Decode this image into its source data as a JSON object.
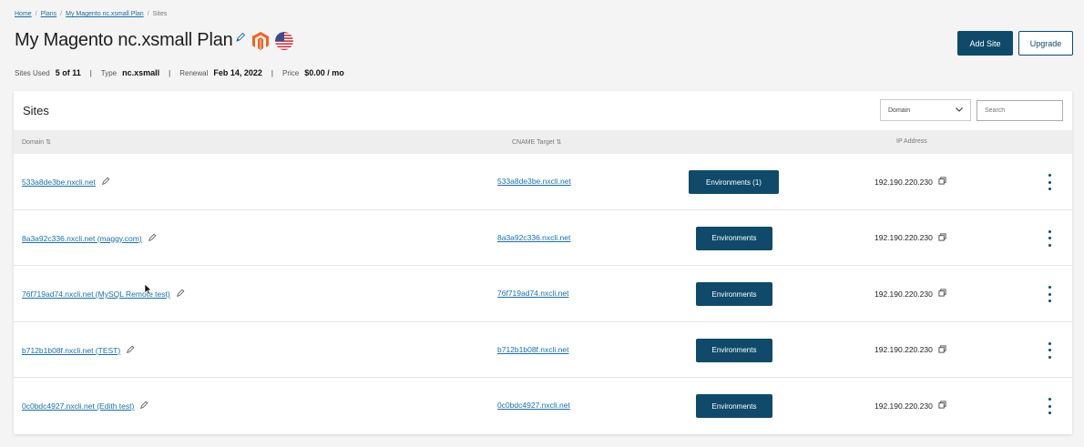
{
  "breadcrumb": {
    "items": [
      "Home",
      "Plans",
      "My Magento nc.xsmall Plan",
      "Sites"
    ]
  },
  "page": {
    "title": "My Magento nc.xsmall Plan"
  },
  "meta": {
    "sites_used_label": "Sites Used",
    "sites_used_value": "5 of 11",
    "type_label": "Type",
    "type_value": "nc.xsmall",
    "renewal_label": "Renewal",
    "renewal_value": "Feb 14, 2022",
    "price_label": "Price",
    "price_value": "$0.00 / mo"
  },
  "actions": {
    "add_site": "Add Site",
    "upgrade": "Upgrade"
  },
  "sites_panel": {
    "title": "Sites",
    "filter_value": "Domain",
    "search_placeholder": "Search",
    "columns": {
      "domain": "Domain ⇅",
      "cname": "CNAME Target ⇅",
      "ip": "IP Address"
    },
    "rows": [
      {
        "domain": "533a8de3be.nxcli.net",
        "cname": "533a8de3be.nxcli.net",
        "env": "Environments (1)",
        "ip": "192.190.220.230"
      },
      {
        "domain": "8a3a92c336.nxcli.net (maggy.com)",
        "cname": "8a3a92c336.nxcli.net",
        "env": "Environments",
        "ip": "192.190.220.230"
      },
      {
        "domain": "76f719ad74.nxcli.net (MySQL Remote test)",
        "cname": "76f719ad74.nxcli.net",
        "env": "Environments",
        "ip": "192.190.220.230"
      },
      {
        "domain": "b712b1b08f.nxcli.net (TEST)",
        "cname": "b712b1b08f.nxcli.net",
        "env": "Environments",
        "ip": "192.190.220.230"
      },
      {
        "domain": "0c0bdc4927.nxcli.net (Edith test)",
        "cname": "0c0bdc4927.nxcli.net",
        "env": "Environments",
        "ip": "192.190.220.230"
      }
    ]
  },
  "colors": {
    "primary": "#0f4a6a",
    "link": "#1a6fa8",
    "magento_orange": "#f26322"
  },
  "icons": [
    "pencil-icon",
    "magento-logo-icon",
    "us-flag-icon",
    "chevron-down-icon",
    "copy-icon",
    "kebab-menu-icon",
    "mouse-cursor-icon"
  ]
}
